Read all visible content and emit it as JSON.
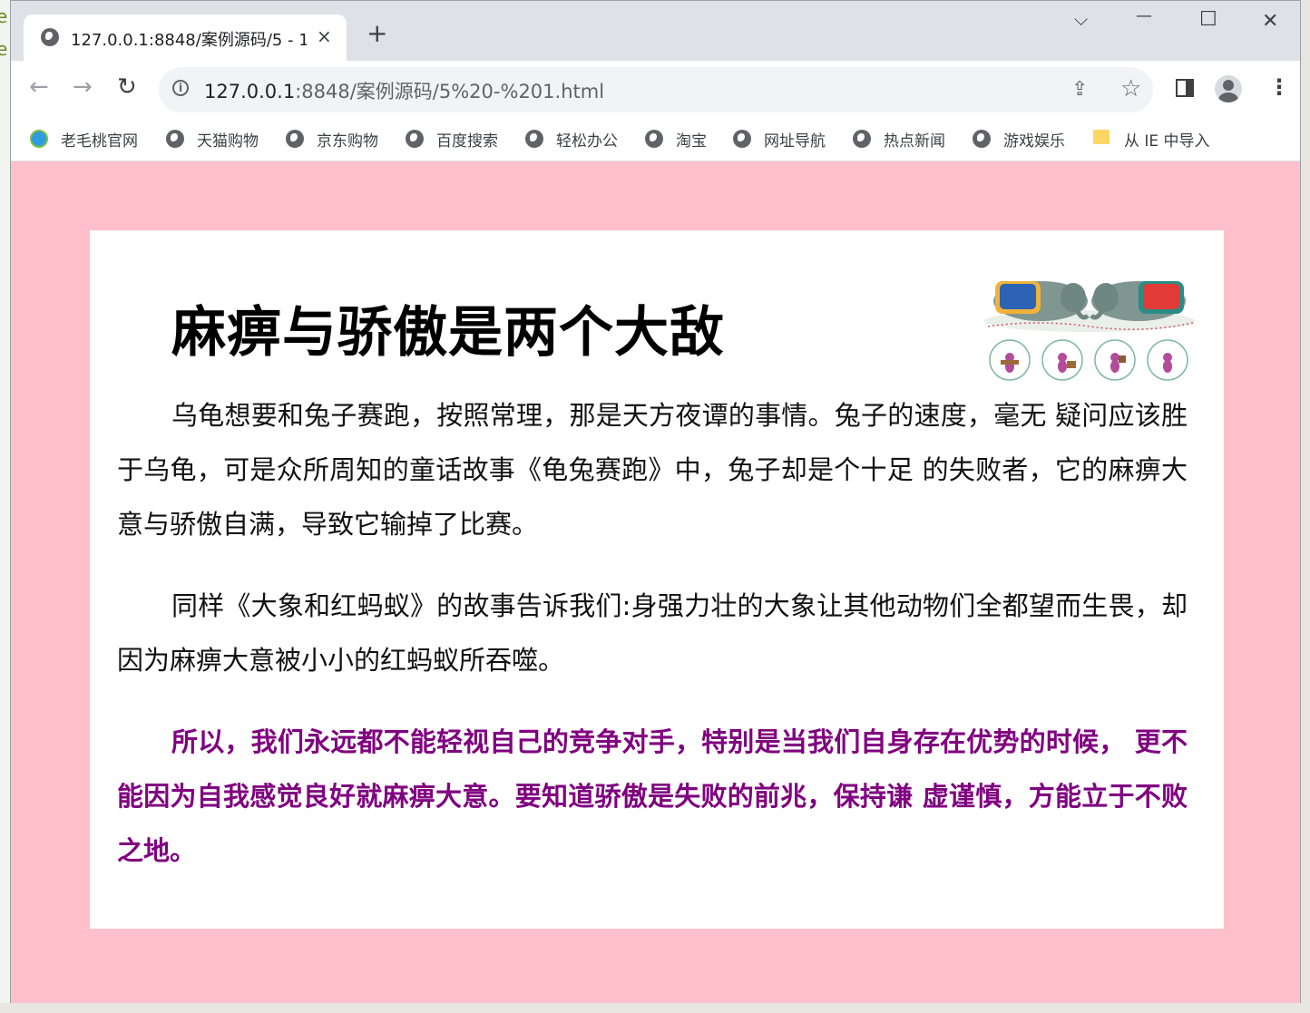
{
  "browser": {
    "tab_title": "127.0.0.1:8848/案例源码/5 - 1.",
    "tab_close": "×",
    "new_tab": "+",
    "url_host": "127.0.0.1",
    "url_path": ":8848/案例源码/5%20-%201.html",
    "window_controls": {
      "dropdown": "⌵",
      "minimize": "—",
      "maximize": "☐",
      "close": "✕"
    }
  },
  "bookmarks": [
    {
      "label": "老毛桃官网",
      "icon": "laomaotao-icon"
    },
    {
      "label": "天猫购物",
      "icon": "globe-icon"
    },
    {
      "label": "京东购物",
      "icon": "globe-icon"
    },
    {
      "label": "百度搜索",
      "icon": "globe-icon"
    },
    {
      "label": "轻松办公",
      "icon": "globe-icon"
    },
    {
      "label": "淘宝",
      "icon": "globe-icon"
    },
    {
      "label": "网址导航",
      "icon": "globe-icon"
    },
    {
      "label": "热点新闻",
      "icon": "globe-icon"
    },
    {
      "label": "游戏娱乐",
      "icon": "globe-icon"
    },
    {
      "label": "从 IE 中导入",
      "icon": "folder-icon"
    }
  ],
  "page": {
    "background": "#ffc0cb",
    "title": "麻痹与骄傲是两个大敌",
    "paragraphs": [
      "乌龟想要和兔子赛跑，按照常理，那是天方夜谭的事情。兔子的速度，毫无 疑问应该胜于乌龟，可是众所周知的童话故事《龟兔赛跑》中，兔子却是个十足 的失败者，它的麻痹大意与骄傲自满，导致它输掉了比赛。",
      "同样《大象和红蚂蚁》的故事告诉我们:身强力壮的大象让其他动物们全都望而生畏，却因为麻痹大意被小小的红蚂蚁所吞噬。",
      "所以，我们永远都不能轻视自己的竞争对手，特别是当我们自身存在优势的时候， 更不能因为自我感觉良好就麻痹大意。要知道骄傲是失败的前兆，保持谦 虚谨慎，方能立于不败之地。"
    ],
    "highlight_color": "#800080"
  }
}
